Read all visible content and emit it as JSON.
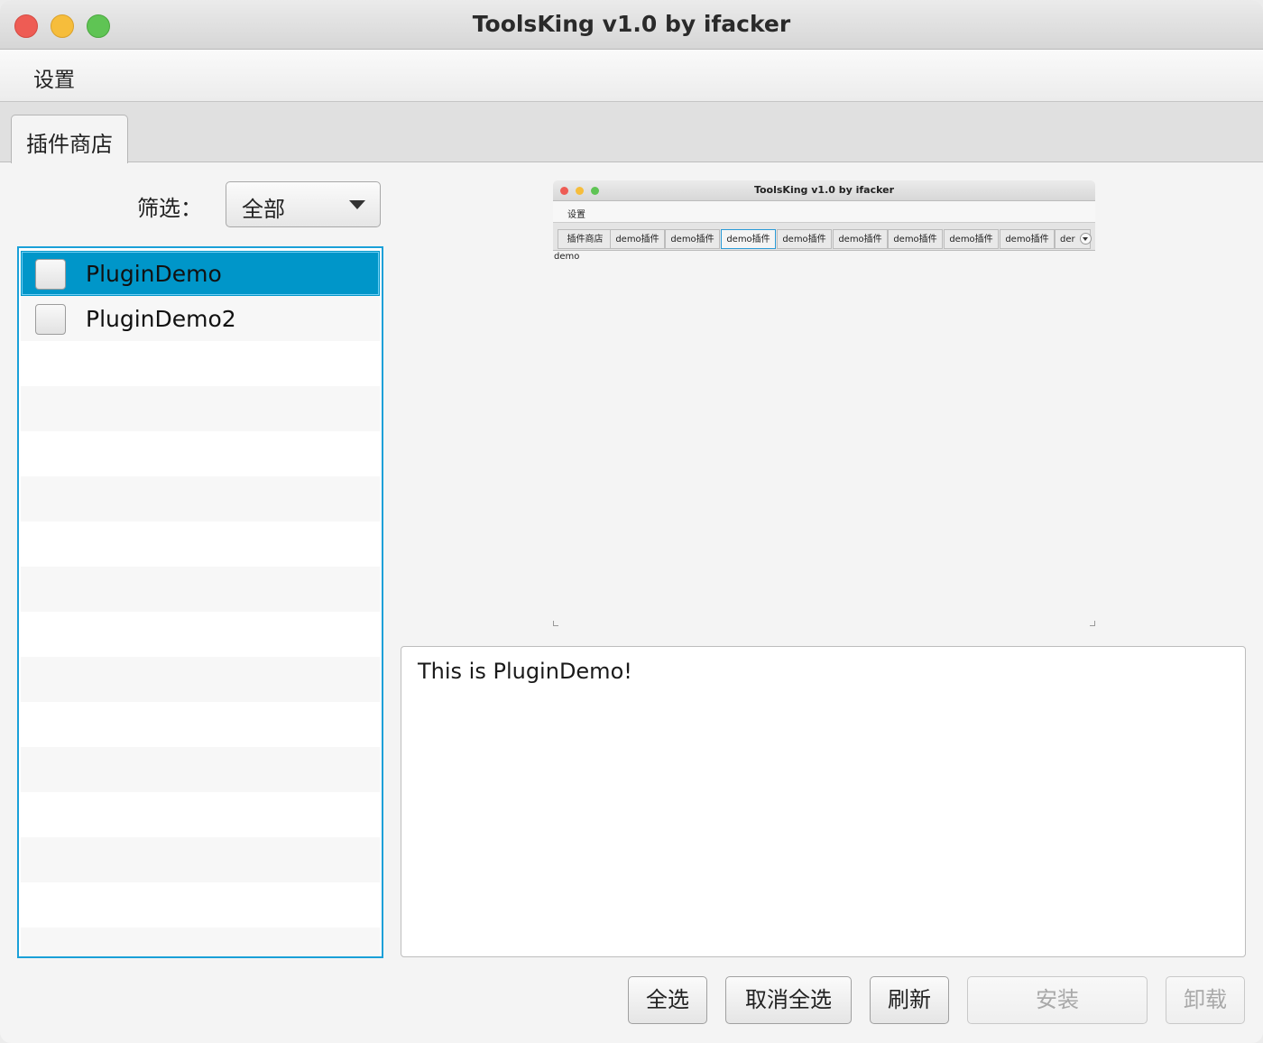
{
  "window": {
    "title": "ToolsKing v1.0 by ifacker"
  },
  "menu": {
    "settings_label": "设置"
  },
  "tabs": [
    {
      "label": "插件商店",
      "active": true
    }
  ],
  "filter": {
    "label": "筛选：",
    "selected": "全部"
  },
  "plugin_list": {
    "items": [
      {
        "name": "PluginDemo",
        "checked": false,
        "selected": true
      },
      {
        "name": "PluginDemo2",
        "checked": false,
        "selected": false
      }
    ]
  },
  "preview": {
    "title": "ToolsKing v1.0 by ifacker",
    "menu_label": "设置",
    "tabs": [
      "插件商店",
      "demo插件",
      "demo插件",
      "demo插件",
      "demo插件",
      "demo插件",
      "demo插件",
      "demo插件",
      "demo插件",
      "der"
    ],
    "active_tab_index": 3,
    "content_text": "demo"
  },
  "description": {
    "text": "This is PluginDemo!"
  },
  "buttons": {
    "select_all": "全选",
    "deselect_all": "取消全选",
    "refresh": "刷新",
    "install": "安装",
    "uninstall": "卸载"
  },
  "colors": {
    "selection": "#0096c9",
    "list_border": "#1aa0d8",
    "close": "#ee5c54",
    "minimize": "#f6bd3b",
    "zoom": "#5fc454"
  }
}
